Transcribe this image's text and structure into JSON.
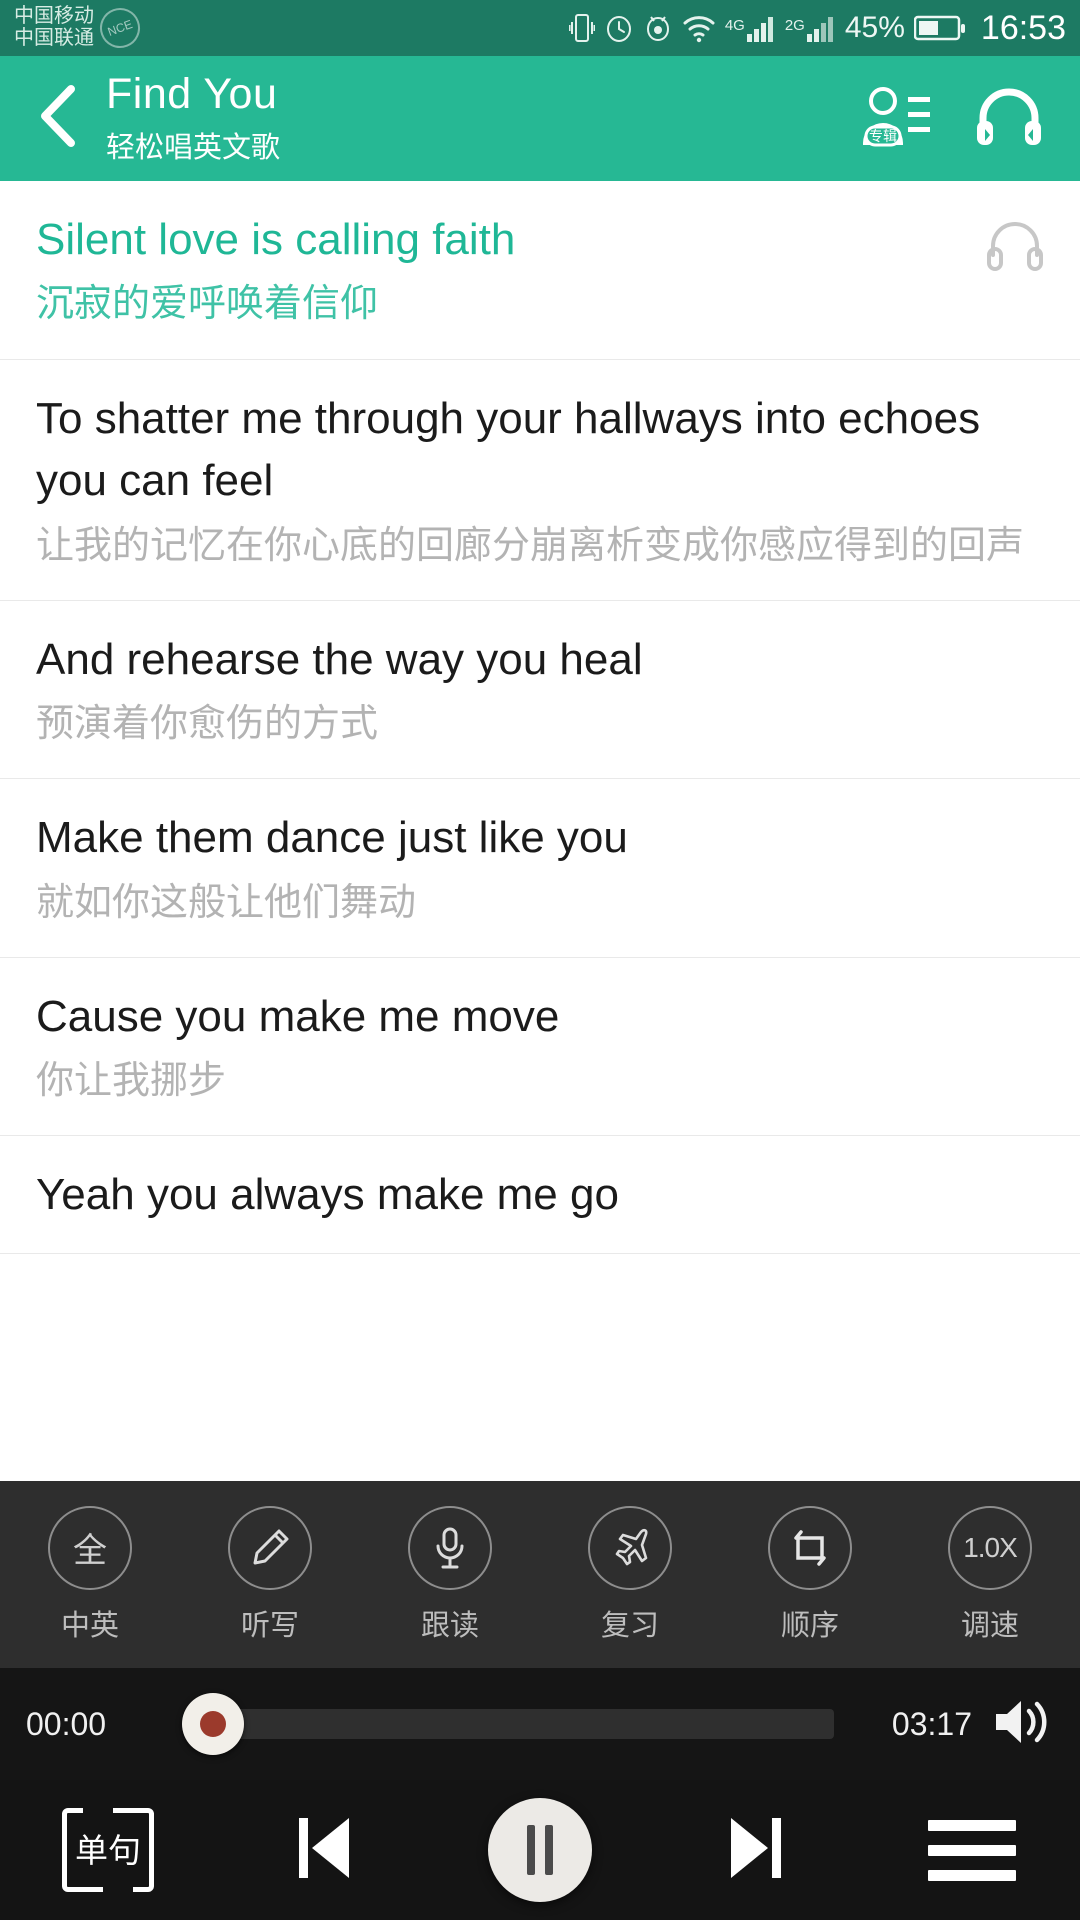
{
  "status_bar": {
    "carriers": [
      "中国移动",
      "中国联通"
    ],
    "app_badge": "NCE",
    "network_labels": [
      "4G",
      "2G"
    ],
    "battery_percent": "45%",
    "clock": "16:53",
    "icons": [
      "vibrate-icon",
      "alarm-icon",
      "eye-care-icon",
      "wifi-icon",
      "signal-icon",
      "battery-icon"
    ]
  },
  "header": {
    "back_icon": "chevron-left-icon",
    "title": "Find You",
    "subtitle": "轻松唱英文歌",
    "album_icon_label": "专辑",
    "actions": [
      "album-list-icon",
      "headphones-icon"
    ]
  },
  "lyrics": [
    {
      "en": "Silent love is calling faith",
      "cn": "沉寂的爱呼唤着信仰",
      "active": true,
      "has_headphone": true
    },
    {
      "en": "To shatter me through your hallways into echoes you can feel",
      "cn": "让我的记忆在你心底的回廊分崩离析变成你感应得到的回声",
      "active": false,
      "has_headphone": false
    },
    {
      "en": "And rehearse the way you heal",
      "cn": "预演着你愈伤的方式",
      "active": false,
      "has_headphone": false
    },
    {
      "en": "Make them dance just like you",
      "cn": "就如你这般让他们舞动",
      "active": false,
      "has_headphone": false
    },
    {
      "en": "Cause you make me move",
      "cn": "你让我挪步",
      "active": false,
      "has_headphone": false
    },
    {
      "en": "Yeah you always make me go",
      "cn": "",
      "active": false,
      "has_headphone": false
    }
  ],
  "toolbar": [
    {
      "glyph": "全",
      "label": "中英",
      "icon": "both-language-icon"
    },
    {
      "glyph": "",
      "label": "听写",
      "icon": "pencil-icon"
    },
    {
      "glyph": "",
      "label": "跟读",
      "icon": "microphone-icon"
    },
    {
      "glyph": "",
      "label": "复习",
      "icon": "airplane-icon"
    },
    {
      "glyph": "",
      "label": "顺序",
      "icon": "repeat-icon"
    },
    {
      "glyph": "1.0X",
      "label": "调速",
      "icon": "speed-icon"
    }
  ],
  "player": {
    "current_time": "00:00",
    "total_time": "03:17",
    "progress_percent": 0,
    "volume_icon": "volume-icon",
    "loop_mode_label": "单句",
    "prev_icon": "previous-track-icon",
    "play_icon": "pause-icon",
    "next_icon": "next-track-icon",
    "menu_icon": "hamburger-menu-icon"
  },
  "colors": {
    "status_bar": "#1d7a63",
    "header": "#26b894",
    "accent": "#1fb796",
    "panel_dark": "#2e2e2e",
    "transport_dark": "#141414",
    "lyric_cn": "#b3b3b3"
  }
}
